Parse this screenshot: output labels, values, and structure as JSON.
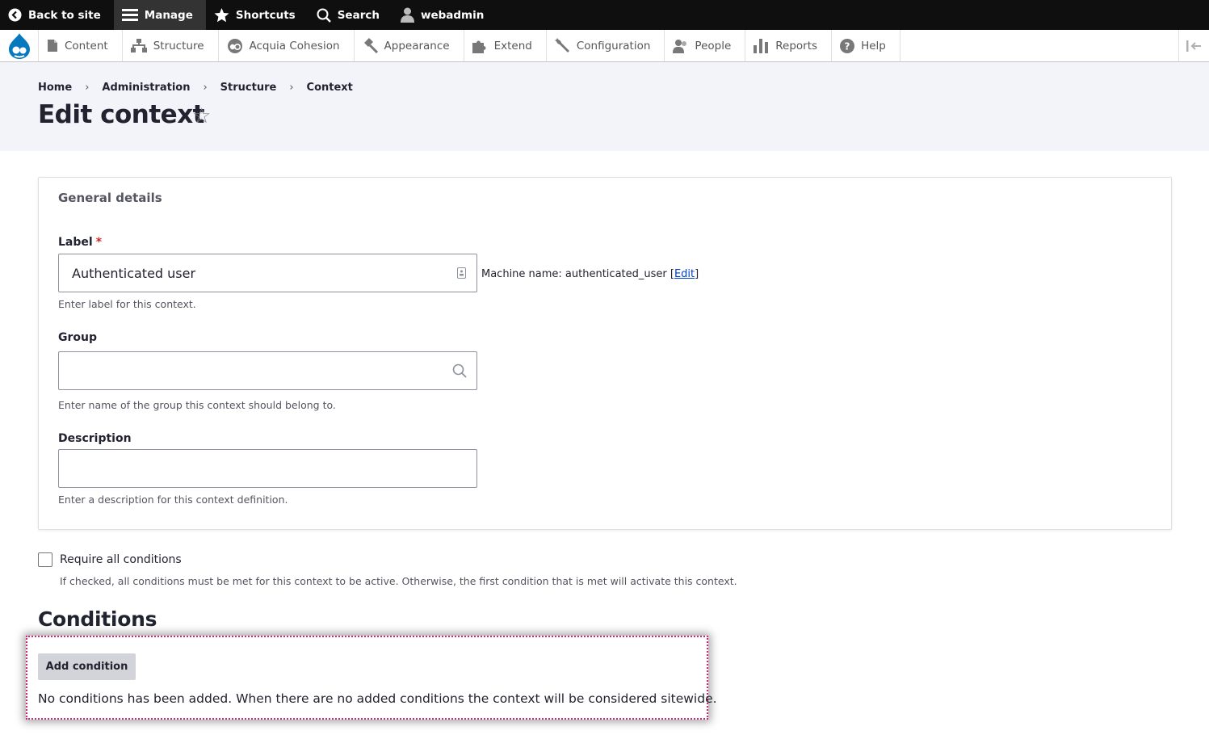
{
  "toolbar": {
    "back": "Back to site",
    "manage": "Manage",
    "shortcuts": "Shortcuts",
    "search": "Search",
    "user": "webadmin"
  },
  "tray": {
    "items": [
      "Content",
      "Structure",
      "Acquia Cohesion",
      "Appearance",
      "Extend",
      "Configuration",
      "People",
      "Reports",
      "Help"
    ]
  },
  "breadcrumb": [
    "Home",
    "Administration",
    "Structure",
    "Context"
  ],
  "page_title": "Edit context",
  "form": {
    "legend": "General details",
    "label_title": "Label",
    "label_value": "Authenticated user",
    "label_desc": "Enter label for this context.",
    "machine_name": "Machine name: authenticated_user",
    "machine_edit": "Edit",
    "group_title": "Group",
    "group_value": "",
    "group_desc": "Enter name of the group this context should belong to.",
    "description_title": "Description",
    "description_value": "",
    "description_desc": "Enter a description for this context definition."
  },
  "require_all": {
    "label": "Require all conditions",
    "desc": "If checked, all conditions must be met for this context to be active. Otherwise, the first condition that is met will activate this context.",
    "checked": false
  },
  "conditions": {
    "heading": "Conditions",
    "add_button": "Add condition",
    "empty_message": "No conditions has been added. When there are no added conditions the context will be considered sitewide."
  }
}
